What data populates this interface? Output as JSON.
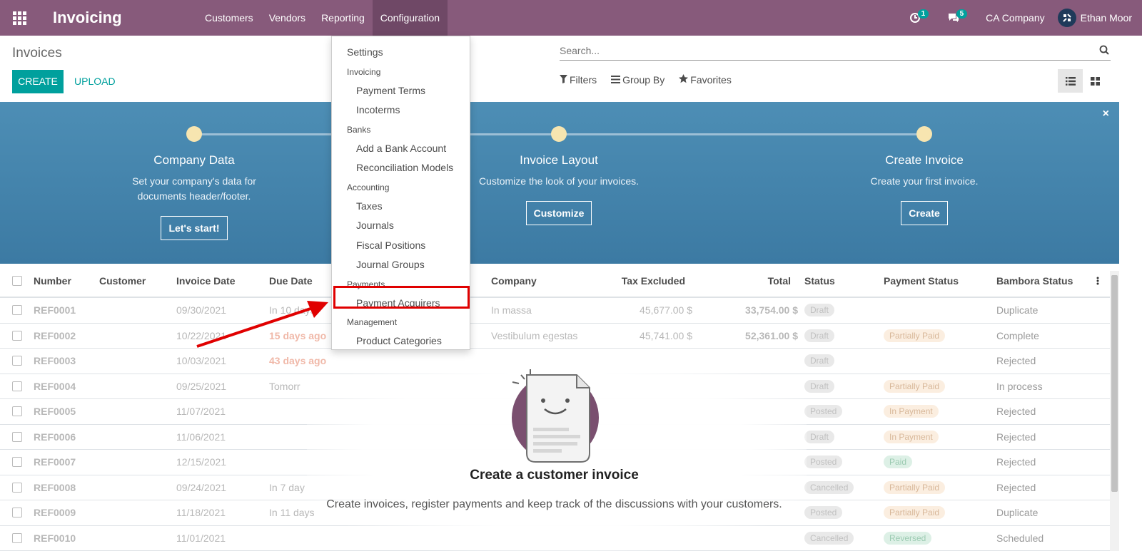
{
  "navbar": {
    "app_name": "Invoicing",
    "menu": [
      "Customers",
      "Vendors",
      "Reporting",
      "Configuration"
    ],
    "activity_count": "1",
    "message_count": "5",
    "company": "CA Company",
    "user": "Ethan Moor",
    "accent": "#875a7b"
  },
  "control_panel": {
    "title": "Invoices",
    "create_label": "CREATE",
    "upload_label": "UPLOAD",
    "search_placeholder": "Search...",
    "filters_label": "Filters",
    "groupby_label": "Group By",
    "favorites_label": "Favorites"
  },
  "banner": {
    "steps": [
      {
        "title": "Company Data",
        "desc": "Set your company's data for documents header/footer.",
        "button": "Let's start!"
      },
      {
        "title": "Invoice Layout",
        "desc": "Customize the look of your invoices.",
        "button": "Customize"
      },
      {
        "title": "Create Invoice",
        "desc": "Create your first invoice.",
        "button": "Create"
      }
    ],
    "close": "×"
  },
  "dropdown": {
    "settings": "Settings",
    "h_invoicing": "Invoicing",
    "payment_terms": "Payment Terms",
    "incoterms": "Incoterms",
    "h_banks": "Banks",
    "add_bank": "Add a Bank Account",
    "reconciliation": "Reconciliation Models",
    "h_accounting": "Accounting",
    "taxes": "Taxes",
    "journals": "Journals",
    "fiscal_positions": "Fiscal Positions",
    "journal_groups": "Journal Groups",
    "h_payments": "Payments",
    "payment_acquirers": "Payment Acquirers",
    "h_management": "Management",
    "product_categories": "Product Categories"
  },
  "table": {
    "headers": {
      "number": "Number",
      "customer": "Customer",
      "invoice_date": "Invoice Date",
      "due_date": "Due Date",
      "company": "Company",
      "tax_excluded": "Tax Excluded",
      "total": "Total",
      "status": "Status",
      "payment_status": "Payment Status",
      "bambora_status": "Bambora Status"
    },
    "rows": [
      {
        "number": "REF0001",
        "date": "09/30/2021",
        "due": "In 10 days",
        "company": "In massa",
        "tax": "45,677.00 $",
        "total": "33,754.00 $",
        "status": "Draft",
        "payment": "",
        "bambora": "Duplicate"
      },
      {
        "number": "REF0002",
        "date": "10/22/2021",
        "due": "15 days ago",
        "company": "Vestibulum egestas",
        "tax": "45,741.00 $",
        "total": "52,361.00 $",
        "status": "Draft",
        "payment": "Partially Paid",
        "bambora": "Complete"
      },
      {
        "number": "REF0003",
        "date": "10/03/2021",
        "due": "43 days ago",
        "company": "",
        "tax": "",
        "total": "",
        "status": "Draft",
        "payment": "",
        "bambora": "Rejected"
      },
      {
        "number": "REF0004",
        "date": "09/25/2021",
        "due": "Tomorr",
        "company": "",
        "tax": "",
        "total": "",
        "status": "Draft",
        "payment": "Partially Paid",
        "bambora": "In process"
      },
      {
        "number": "REF0005",
        "date": "11/07/2021",
        "due": "",
        "company": "",
        "tax": "",
        "total": "",
        "status": "Posted",
        "payment": "In Payment",
        "bambora": "Rejected"
      },
      {
        "number": "REF0006",
        "date": "11/06/2021",
        "due": "",
        "company": "",
        "tax": "",
        "total": "",
        "status": "Draft",
        "payment": "In Payment",
        "bambora": "Rejected"
      },
      {
        "number": "REF0007",
        "date": "12/15/2021",
        "due": "",
        "company": "",
        "tax": "",
        "total": "",
        "status": "Posted",
        "payment": "Paid",
        "bambora": "Rejected"
      },
      {
        "number": "REF0008",
        "date": "09/24/2021",
        "due": "In 7 day",
        "company": "",
        "tax": "",
        "total": "",
        "status": "Cancelled",
        "payment": "Partially Paid",
        "bambora": "Rejected"
      },
      {
        "number": "REF0009",
        "date": "11/18/2021",
        "due": "In 11 days",
        "company": "",
        "tax": "",
        "total": "",
        "status": "Posted",
        "payment": "Partially Paid",
        "bambora": "Duplicate"
      },
      {
        "number": "REF0010",
        "date": "11/01/2021",
        "due": "",
        "company": "",
        "tax": "",
        "total": "",
        "status": "Cancelled",
        "payment": "Reversed",
        "bambora": "Scheduled"
      }
    ]
  },
  "helper": {
    "title": "Create a customer invoice",
    "desc": "Create invoices, register payments and keep track of the discussions with your customers."
  }
}
